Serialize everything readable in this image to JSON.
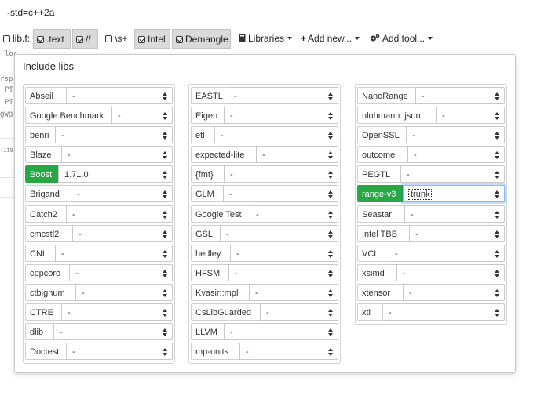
{
  "compiler_options": {
    "value": "-std=c++2a"
  },
  "toolbar": {
    "items": [
      {
        "label": "lib.f:",
        "checked": false
      },
      {
        "label": ".text",
        "checked": true
      },
      {
        "label": "//",
        "checked": true
      },
      {
        "label": "\\s+",
        "checked": false
      },
      {
        "label": "Intel",
        "checked": true
      },
      {
        "label": "Demangle",
        "checked": true
      }
    ],
    "libraries_label": "Libraries",
    "add_new_label": "Add new...",
    "add_tool_label": "Add tool..."
  },
  "background_code": [
    "loc ...",
    "rsp",
    "PT",
    "PT",
    "QWO",
    "-119"
  ],
  "panel": {
    "title": "Include libs",
    "columns": [
      [
        {
          "name": "Abseil",
          "value": "-"
        },
        {
          "name": "Google Benchmark",
          "value": "-"
        },
        {
          "name": "benri",
          "value": "-"
        },
        {
          "name": "Blaze",
          "value": "-"
        },
        {
          "name": "Boost",
          "value": "1.71.0",
          "active": true
        },
        {
          "name": "Brigand",
          "value": "-"
        },
        {
          "name": "Catch2",
          "value": "-"
        },
        {
          "name": "cmcstl2",
          "value": "-"
        },
        {
          "name": "CNL",
          "value": "-"
        },
        {
          "name": "cppcoro",
          "value": "-"
        },
        {
          "name": "ctbignum",
          "value": "-"
        },
        {
          "name": "CTRE",
          "value": "-"
        },
        {
          "name": "dlib",
          "value": "-"
        },
        {
          "name": "Doctest",
          "value": "-"
        }
      ],
      [
        {
          "name": "EASTL",
          "value": "-"
        },
        {
          "name": "Eigen",
          "value": "-"
        },
        {
          "name": "etl",
          "value": "-"
        },
        {
          "name": "expected-lite",
          "value": "-"
        },
        {
          "name": "{fmt}",
          "value": "-"
        },
        {
          "name": "GLM",
          "value": "-"
        },
        {
          "name": "Google Test",
          "value": "-"
        },
        {
          "name": "GSL",
          "value": "-"
        },
        {
          "name": "hedley",
          "value": "-"
        },
        {
          "name": "HFSM",
          "value": "-"
        },
        {
          "name": "Kvasir::mpl",
          "value": "-"
        },
        {
          "name": "CsLibGuarded",
          "value": "-"
        },
        {
          "name": "LLVM",
          "value": "-"
        },
        {
          "name": "mp-units",
          "value": "-"
        }
      ],
      [
        {
          "name": "NanoRange",
          "value": "-"
        },
        {
          "name": "nlohmann::json",
          "value": "-"
        },
        {
          "name": "OpenSSL",
          "value": "-"
        },
        {
          "name": "outcome",
          "value": "-"
        },
        {
          "name": "PEGTL",
          "value": "-"
        },
        {
          "name": "range-v3",
          "value": "trunk",
          "active": true,
          "focused": true
        },
        {
          "name": "Seastar",
          "value": "-"
        },
        {
          "name": "Intel TBB",
          "value": "-"
        },
        {
          "name": "VCL",
          "value": "-"
        },
        {
          "name": "xsimd",
          "value": "-"
        },
        {
          "name": "xtensor",
          "value": "-"
        },
        {
          "name": "xtl",
          "value": "-"
        }
      ]
    ]
  },
  "colors": {
    "active": "#28a745",
    "focus": "#80bdff"
  }
}
